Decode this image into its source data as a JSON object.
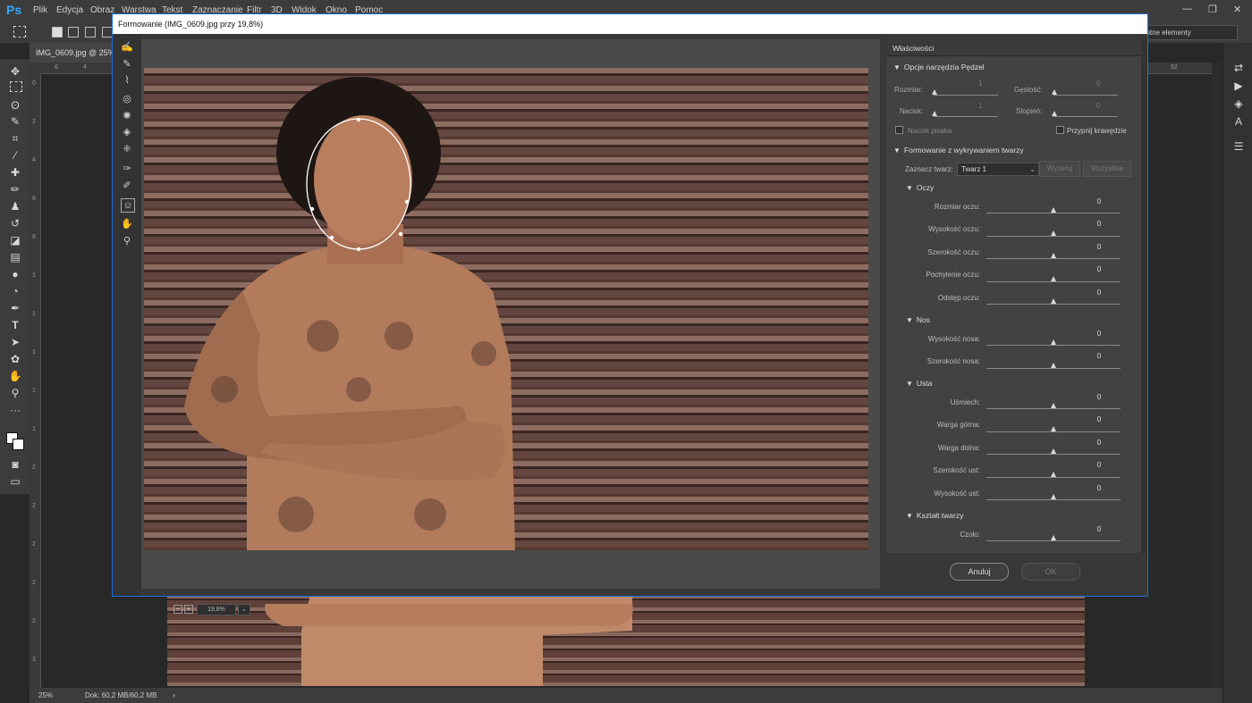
{
  "app": {
    "logo": "Ps",
    "menu": [
      "Plik",
      "Edycja",
      "Obraz",
      "Warstwa",
      "Tekst",
      "Zaznaczanie",
      "Filtr",
      "3D",
      "Widok",
      "Okno",
      "Pomoc"
    ],
    "window_controls": [
      "—",
      "❐",
      "✕"
    ],
    "workspace": "Istotne elementy"
  },
  "document": {
    "tab_label": "IMG_0609.jpg @ 25% (",
    "zoom": "25%",
    "doc_info": "Dok: 60,2 MB/60,2 MB",
    "ruler_top": [
      "6",
      "4",
      "52"
    ],
    "ruler_left": [
      "0",
      "2",
      "4",
      "6",
      "8",
      "1",
      "1",
      "1",
      "1",
      "1",
      "2",
      "2",
      "2",
      "2",
      "2",
      "3"
    ]
  },
  "dialog": {
    "title": "Formowanie (IMG_0609.jpg przy 19,8%)",
    "zoom": "19,8%",
    "cancel": "Anuluj",
    "ok": "OK"
  },
  "props": {
    "title": "Właściwości",
    "brush_section": "Opcje narzędzia Pędzel",
    "size": "Rozmiar:",
    "density": "Gęstość:",
    "pressure": "Nacisk:",
    "rate": "Stopień:",
    "size_val": "1",
    "density_val": "0",
    "pressure_val": "1",
    "rate_val": "0",
    "stylus": "Nacisk pisaka",
    "pin_edges": "Przypnij krawędzie",
    "face_section": "Formowanie z wykrywaniem twarzy",
    "select_face": "Zaznacz twarz:",
    "face_value": "Twarz 1",
    "reset": "Wyzeruj",
    "all": "Wszystkie",
    "eyes": "Oczy",
    "nose": "Nos",
    "mouth": "Usta",
    "face_shape": "Kształt twarzy",
    "eye_sliders": [
      {
        "label": "Rozmiar oczu:",
        "value": "0"
      },
      {
        "label": "Wysokość oczu:",
        "value": "0"
      },
      {
        "label": "Szerokość oczu:",
        "value": "0"
      },
      {
        "label": "Pochylenie oczu:",
        "value": "0"
      },
      {
        "label": "Odstęp oczu:",
        "value": "0"
      }
    ],
    "nose_sliders": [
      {
        "label": "Wysokość nosa:",
        "value": "0"
      },
      {
        "label": "Szerokość nosa:",
        "value": "0"
      }
    ],
    "mouth_sliders": [
      {
        "label": "Uśmiech:",
        "value": "0"
      },
      {
        "label": "Warga górna:",
        "value": "0"
      },
      {
        "label": "Warga dolna:",
        "value": "0"
      },
      {
        "label": "Szerokość ust:",
        "value": "0"
      },
      {
        "label": "Wysokość ust:",
        "value": "0"
      }
    ],
    "shape_sliders": [
      {
        "label": "Czoło:",
        "value": "0"
      }
    ]
  }
}
